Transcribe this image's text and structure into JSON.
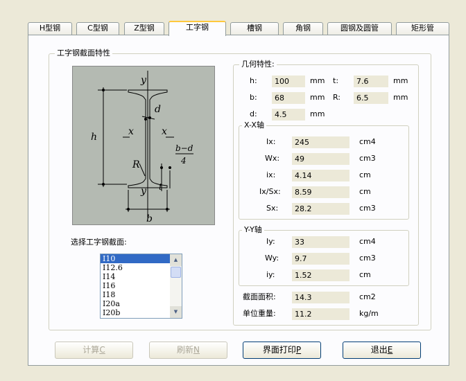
{
  "tabs": [
    "H型钢",
    "C型钢",
    "Z型钢",
    "工字钢",
    "槽钢",
    "角钢",
    "圆钢及圆管",
    "矩形管"
  ],
  "active_tab": "工字钢",
  "section_group_title": "工字钢截面特性",
  "diagram_labels": {
    "y_top": "y",
    "y_bottom": "y",
    "x_left": "x",
    "x_right": "x",
    "h": "h",
    "d": "d",
    "R": "R",
    "t": "t",
    "b": "b",
    "slope_num": "b−d",
    "slope_den": "4"
  },
  "select_label": "选择工字钢截面:",
  "sections": [
    "I10",
    "I12.6",
    "I14",
    "I16",
    "I18",
    "I20a",
    "I20b"
  ],
  "selected_section": "I10",
  "geometry": {
    "title": "几何特性:",
    "h": {
      "label": "h:",
      "value": "100",
      "unit": "mm"
    },
    "t": {
      "label": "t:",
      "value": "7.6",
      "unit": "mm"
    },
    "b": {
      "label": "b:",
      "value": "68",
      "unit": "mm"
    },
    "R": {
      "label": "R:",
      "value": "6.5",
      "unit": "mm"
    },
    "d": {
      "label": "d:",
      "value": "4.5",
      "unit": "mm"
    }
  },
  "xx_axis": {
    "title": "X-X轴",
    "rows": [
      {
        "label": "Ix:",
        "value": "245",
        "unit": "cm4"
      },
      {
        "label": "Wx:",
        "value": "49",
        "unit": "cm3"
      },
      {
        "label": "ix:",
        "value": "4.14",
        "unit": "cm"
      },
      {
        "label": "Ix/Sx:",
        "value": "8.59",
        "unit": "cm"
      },
      {
        "label": "Sx:",
        "value": "28.2",
        "unit": "cm3"
      }
    ]
  },
  "yy_axis": {
    "title": "Y-Y轴",
    "rows": [
      {
        "label": "Iy:",
        "value": "33",
        "unit": "cm4"
      },
      {
        "label": "Wy:",
        "value": "9.7",
        "unit": "cm3"
      },
      {
        "label": "iy:",
        "value": "1.52",
        "unit": "cm"
      }
    ]
  },
  "area": {
    "label": "截面面积:",
    "value": "14.3",
    "unit": "cm2"
  },
  "weight": {
    "label": "单位重量:",
    "value": "11.2",
    "unit": "kg/m"
  },
  "buttons": {
    "calc": {
      "text": "计算",
      "key": "C"
    },
    "refresh": {
      "text": "刷新",
      "key": "N"
    },
    "print": {
      "text": "界面打印",
      "key": "P"
    },
    "exit": {
      "text": "退出",
      "key": "E"
    }
  }
}
